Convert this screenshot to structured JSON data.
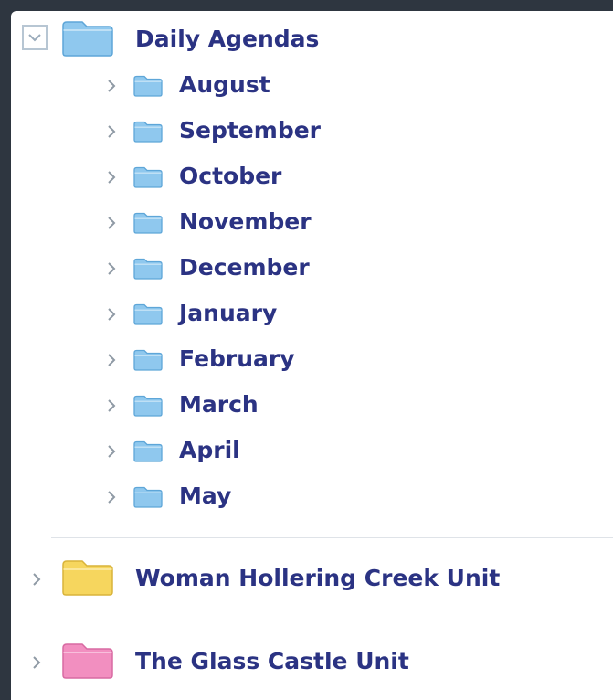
{
  "colors": {
    "label": "#2b3383",
    "blue_folder": "#8fc8ee",
    "yellow_folder": "#f6d65e",
    "pink_folder": "#f28fc0",
    "background": "#2e3640"
  },
  "tree": {
    "expanded": {
      "label": "Daily Agendas",
      "toggle_icon": "chevron-down-icon",
      "folder_icon": "folder-icon",
      "children": [
        {
          "label": "August"
        },
        {
          "label": "September"
        },
        {
          "label": "October"
        },
        {
          "label": "November"
        },
        {
          "label": "December"
        },
        {
          "label": "January"
        },
        {
          "label": "February"
        },
        {
          "label": "March"
        },
        {
          "label": "April"
        },
        {
          "label": "May"
        }
      ]
    },
    "collapsed": [
      {
        "label": "Woman Hollering Creek Unit",
        "folder_color": "yellow"
      },
      {
        "label": "The Glass Castle Unit",
        "folder_color": "pink"
      }
    ]
  }
}
